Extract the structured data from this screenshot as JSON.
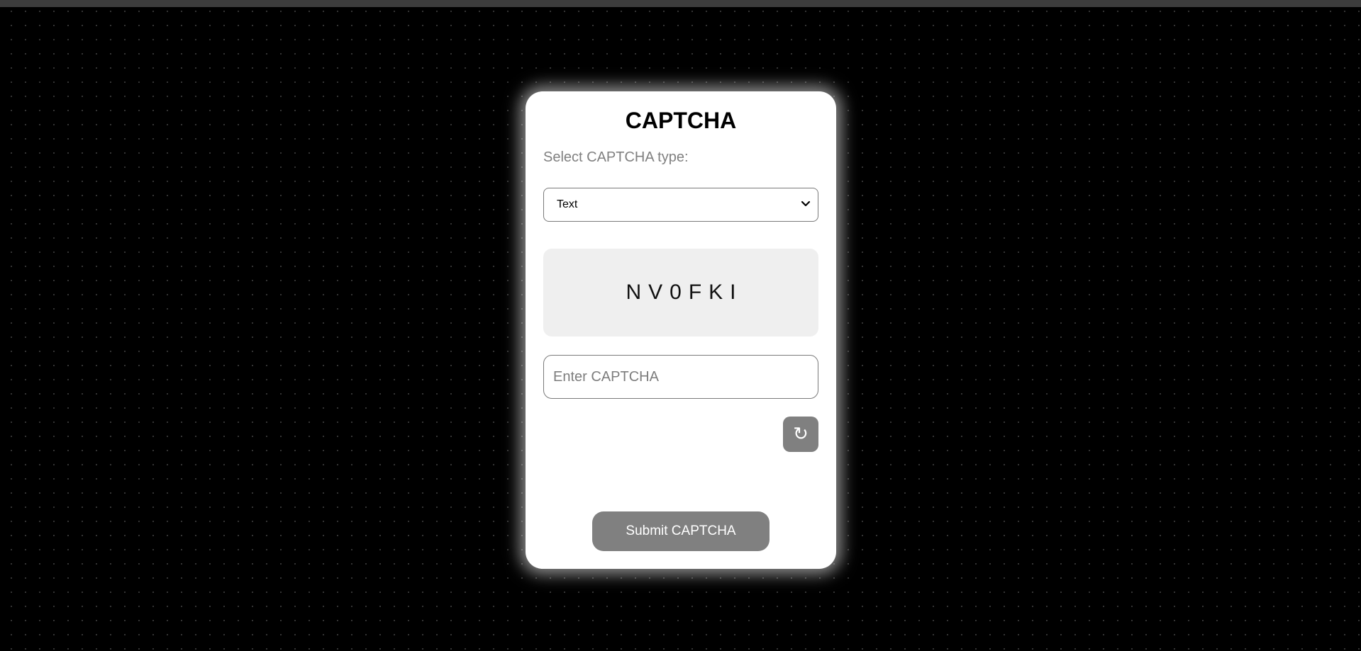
{
  "captcha_card": {
    "title": "CAPTCHA",
    "type_label": "Select CAPTCHA type:",
    "type_select": {
      "selected": "Text"
    },
    "challenge_text": "NV0FKI",
    "input": {
      "placeholder": "Enter CAPTCHA",
      "value": ""
    },
    "refresh_icon": "↻",
    "submit_label": "Submit CAPTCHA"
  },
  "colors": {
    "page_background": "#000000",
    "card_background": "#ffffff",
    "button_gray": "#808080",
    "captcha_box": "#efefef"
  },
  "icons": {
    "refresh": "refresh-icon",
    "select_chevron": "chevron-down-icon"
  }
}
